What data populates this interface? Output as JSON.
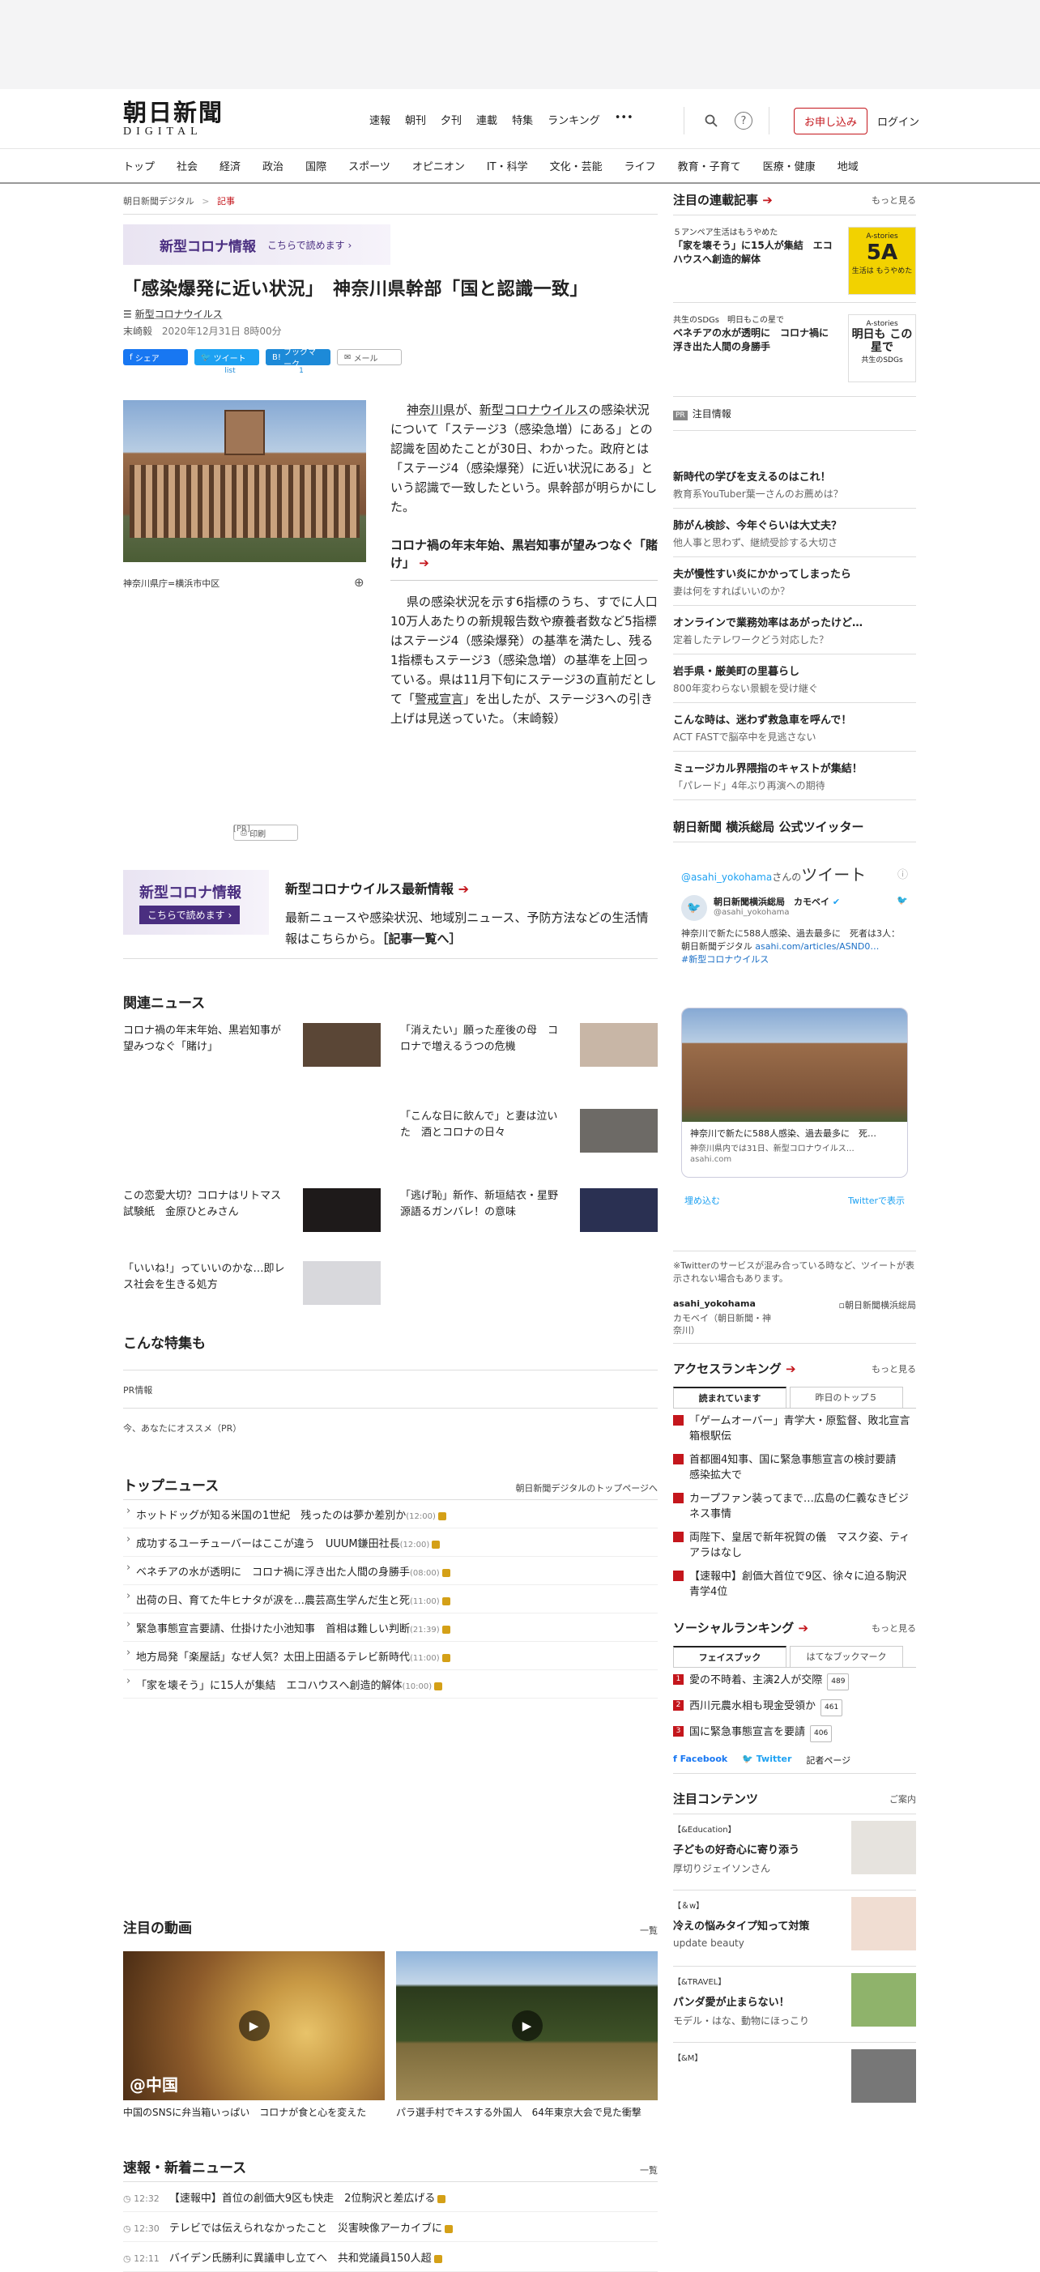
{
  "header": {
    "logo_top": "朝日新聞",
    "logo_bottom": "DIGITAL",
    "topnav": [
      "速報",
      "朝刊",
      "夕刊",
      "連載",
      "特集",
      "ランキング",
      "•••"
    ],
    "subscribe": "お申し込み",
    "login": "ログイン"
  },
  "catnav": [
    "トップ",
    "社会",
    "経済",
    "政治",
    "国際",
    "スポーツ",
    "オピニオン",
    "IT・科学",
    "文化・芸能",
    "ライフ",
    "教育・子育て",
    "医療・健康",
    "地域"
  ],
  "breadcrumb": {
    "home": "朝日新聞デジタル",
    "sep": ">",
    "current": "記事"
  },
  "covid_banner": {
    "title": "新型コロナ情報",
    "link": "こちらで読めます ›"
  },
  "article": {
    "title": "「感染爆発に近い状況」　神奈川県幹部「国と認識一致」",
    "tag": "新型コロナウイルス",
    "author": "末崎毅",
    "date": "2020年12月31日 8時00分",
    "share": {
      "fb": "シェア",
      "tw": "ツイート",
      "hb": "ブックマーク",
      "mail": "メール",
      "print": "印刷",
      "tw_count": "list",
      "hb_count": "1"
    },
    "caption": "神奈川県庁=横浜市中区",
    "p1": [
      {
        "text": "神奈川県",
        "ul": true
      },
      {
        "text": "が、",
        "ul": false
      },
      {
        "text": "新型コロナウイルス",
        "ul": true
      },
      {
        "text": "の感染状況について「ステージ3（感染急増）にある」との認識を固めたことが30日、わかった。政府とは「ステージ4（感染爆発）に近い状況にある」という認識で一致したという。県幹部が明らかにした。",
        "ul": false
      }
    ],
    "midlink": "コロナ禍の年末年始、黒岩知事が望みつなぐ「賭け」",
    "p2": [
      {
        "text": "県の感染状況を示す6指標のうち、すでに人口10万人あたりの新規報告数や療養者数など5指標はステージ4（感染爆発）の基準を満たし、残る1指標もステージ3（感染急増）の基準を上回っている。県は11月下旬にステージ3の直前だとして「",
        "ul": false
      },
      {
        "text": "警戒宣言",
        "ul": true
      },
      {
        "text": "」を出したが、ステージ3への引き上げは見送っていた。（末崎毅）",
        "ul": false
      }
    ],
    "pr": "[PR]"
  },
  "promo": {
    "img_title": "新型コロナ情報",
    "img_btn": "こちらで読めます ›",
    "title": "新型コロナウイルス最新情報",
    "desc": "最新ニュースや感染状況、地域別ニュース、予防方法などの生活情報はこちらから。",
    "link": "［記事一覧へ］"
  },
  "related": {
    "heading": "関連ニュース",
    "items": [
      {
        "text": "コロナ禍の年末年始、黒岩知事が望みつなぐ「賭け」",
        "color": "#5a4636"
      },
      {
        "text": "「消えたい」願った産後の母　コロナで増えるうつの危機",
        "color": "#c8b6a6"
      },
      {
        "text": "「こんな日に飲んで」と妻は泣いた　酒とコロナの日々",
        "color": "#6d6a66"
      },
      {
        "text": "この恋愛大切？コロナはリトマス試験紙　金原ひとみさん",
        "color": "#1e1a1a"
      },
      {
        "text": "「逃げ恥」新作、新垣結衣・星野源語るガンバレ！の意味",
        "color": "#2a3052"
      },
      {
        "text": "「いいね!」っていいのかな…即レス社会を生きる処方",
        "color": "#d8d8dc"
      }
    ]
  },
  "features": {
    "heading": "こんな特集も",
    "row1": "PR情報",
    "row2": "今、あなたにオススメ（PR）"
  },
  "topnews": {
    "heading": "トップニュース",
    "more": "朝日新聞デジタルのトップページへ",
    "items": [
      {
        "text": "ホットドッグが知る米国の1世紀　残ったのは夢か差別か",
        "time": "(12:00)"
      },
      {
        "text": "成功するユーチューバーはここが違う　UUUM鎌田社長",
        "time": "(12:00)"
      },
      {
        "text": "ベネチアの水が透明に　コロナ禍に浮き出た人間の身勝手",
        "time": "(08:00)"
      },
      {
        "text": "出荷の日、育てた牛ヒナタが涙を…農芸高生学んだ生と死",
        "time": "(11:00)"
      },
      {
        "text": "緊急事態宣言要請、仕掛けた小池知事　首相は難しい判断",
        "time": "(21:39)"
      },
      {
        "text": "地方局発「楽屋話」なぜ人気？太田上田語るテレビ新時代",
        "time": "(11:00)"
      },
      {
        "text": "「家を壊そう」に15人が集結　エコハウスへ創造的解体",
        "time": "(10:00)"
      }
    ]
  },
  "videos": {
    "heading": "注目の動画",
    "more": "一覧",
    "items": [
      {
        "label": "@中国",
        "caption": "中国のSNSに弁当箱いっぱい　コロナが食と心を変えた"
      },
      {
        "label": "",
        "caption": "パラ選手村でキスする外国人　64年東京大会で見た衝撃"
      }
    ]
  },
  "breaking": {
    "heading": "速報・新着ニュース",
    "more": "一覧",
    "items": [
      {
        "time": "12:32",
        "text": "【速報中】首位の創価大9区も快走　2位駒沢と差広げる"
      },
      {
        "time": "12:30",
        "text": "テレビでは伝えられなかったこと　災害映像アーカイブに"
      },
      {
        "time": "12:11",
        "text": "バイデン氏勝利に異議申し立てへ　共和党議員150人超"
      }
    ]
  },
  "side": {
    "series_heading": "注目の連載記事",
    "series_more": "もっと見る",
    "series": [
      {
        "kicker": "５アンペア生活はもうやめた",
        "title": "「家を壊そう」に15人が集結　エコハウスへ創造的解体",
        "img_top": "A-stories",
        "img_big": "5A",
        "img_sub": "生活は もうやめた",
        "bg": "#f2d200"
      },
      {
        "kicker": "共生のSDGs　明日もこの星で",
        "title": "ベネチアの水が透明に　コロナ禍に浮き出た人間の身勝手",
        "img_top": "A-stories",
        "img_big": "明日も この星で",
        "img_sub": "共生のSDGs",
        "bg": "#ffffff"
      }
    ],
    "pr_heading": "注目情報",
    "pr_badge": "PR",
    "pr_items": [
      {
        "t": "新時代の学びを支えるのはこれ！",
        "s": "教育系YouTuber葉一さんのお薦めは？"
      },
      {
        "t": "肺がん検診、今年ぐらいは大丈夫？",
        "s": "他人事と思わず、継続受診する大切さ"
      },
      {
        "t": "夫が慢性すい炎にかかってしまったら",
        "s": "妻は何をすればいいのか？"
      },
      {
        "t": "オンラインで業務効率はあがったけど…",
        "s": "定着したテレワークどう対応した？"
      },
      {
        "t": "岩手県・厳美町の里暮らし",
        "s": "800年変わらない景観を受け継ぐ"
      },
      {
        "t": "こんな時は、迷わず救急車を呼んで！",
        "s": "ACT FASTで脳卒中を見逃さない"
      },
      {
        "t": "ミュージカル界隈指のキャストが集結！",
        "s": "「パレード」4年ぶり再演への期待"
      }
    ],
    "twitter": {
      "heading": "朝日新聞 横浜総局 公式ツイッター",
      "handle_line": "@asahi_yokohama",
      "san": "さんの",
      "tweet_word": "ツイート",
      "name": "朝日新聞横浜総局　カモベイ",
      "handle": "@asahi_yokohama",
      "text": "神奈川で新たに588人感染、過去最多に　死者は3人：朝日新聞デジタル",
      "url": "asahi.com/articles/ASND0…",
      "hashtag": "#新型コロナウイルス",
      "card_title": "神奈川で新たに588人感染、過去最多に　死…",
      "card_sub": "神奈川県内では31日、新型コロナウイルス…",
      "card_url": "asahi.com",
      "embed": "埋め込む",
      "view": "Twitterで表示",
      "note": "※Twitterのサービスが混み合っている時など、ツイートが表示されない場合もあります。",
      "acct": "asahi_yokohama",
      "acct_sub": "カモベイ（朝日新聞・神奈川）",
      "acct_img": "朝日新聞横浜総局"
    },
    "access": {
      "heading": "アクセスランキング",
      "more": "もっと見る",
      "tab1": "読まれています",
      "tab2": "昨日のトップ５",
      "items": [
        "「ゲームオーバー」青学大・原監督、敗北宣言　箱根駅伝",
        "首都圏4知事、国に緊急事態宣言の検討要請　感染拡大で",
        "カープファン装ってまで…広島の仁義なきビジネス事情",
        "両陛下、皇居で新年祝賀の儀　マスク姿、ティアラはなし",
        "【速報中】創価大首位で9区、徐々に迫る駒沢　青学4位"
      ]
    },
    "social": {
      "heading": "ソーシャルランキング",
      "more": "もっと見る",
      "tab1": "フェイスブック",
      "tab2": "はてなブックマーク",
      "items": [
        {
          "t": "愛の不時着、主演2人が交際",
          "n": "489"
        },
        {
          "t": "西川元農水相も現金受領か",
          "n": "461"
        },
        {
          "t": "国に緊急事態宣言を要請",
          "n": "406"
        }
      ],
      "fb": "Facebook",
      "tw": "Twitter",
      "kisha": "記者ページ"
    },
    "contents": {
      "heading": "注目コンテンツ",
      "more": "ご案内",
      "items": [
        {
          "k": "【&Education】",
          "t": "子どもの好奇心に寄り添う",
          "s": "厚切りジェイソンさん",
          "bg": "#e6e3de"
        },
        {
          "k": "【＆w】",
          "t": "冷えの悩みタイプ知って対策",
          "s": "update beauty",
          "bg": "#f0ddd2"
        },
        {
          "k": "【&TRAVEL】",
          "t": "パンダ愛が止まらない！",
          "s": "モデル・はな、動物にほっこり",
          "bg": "#8fb36b"
        },
        {
          "k": "【&M】",
          "t": "",
          "s": "",
          "bg": "#777"
        }
      ]
    }
  }
}
